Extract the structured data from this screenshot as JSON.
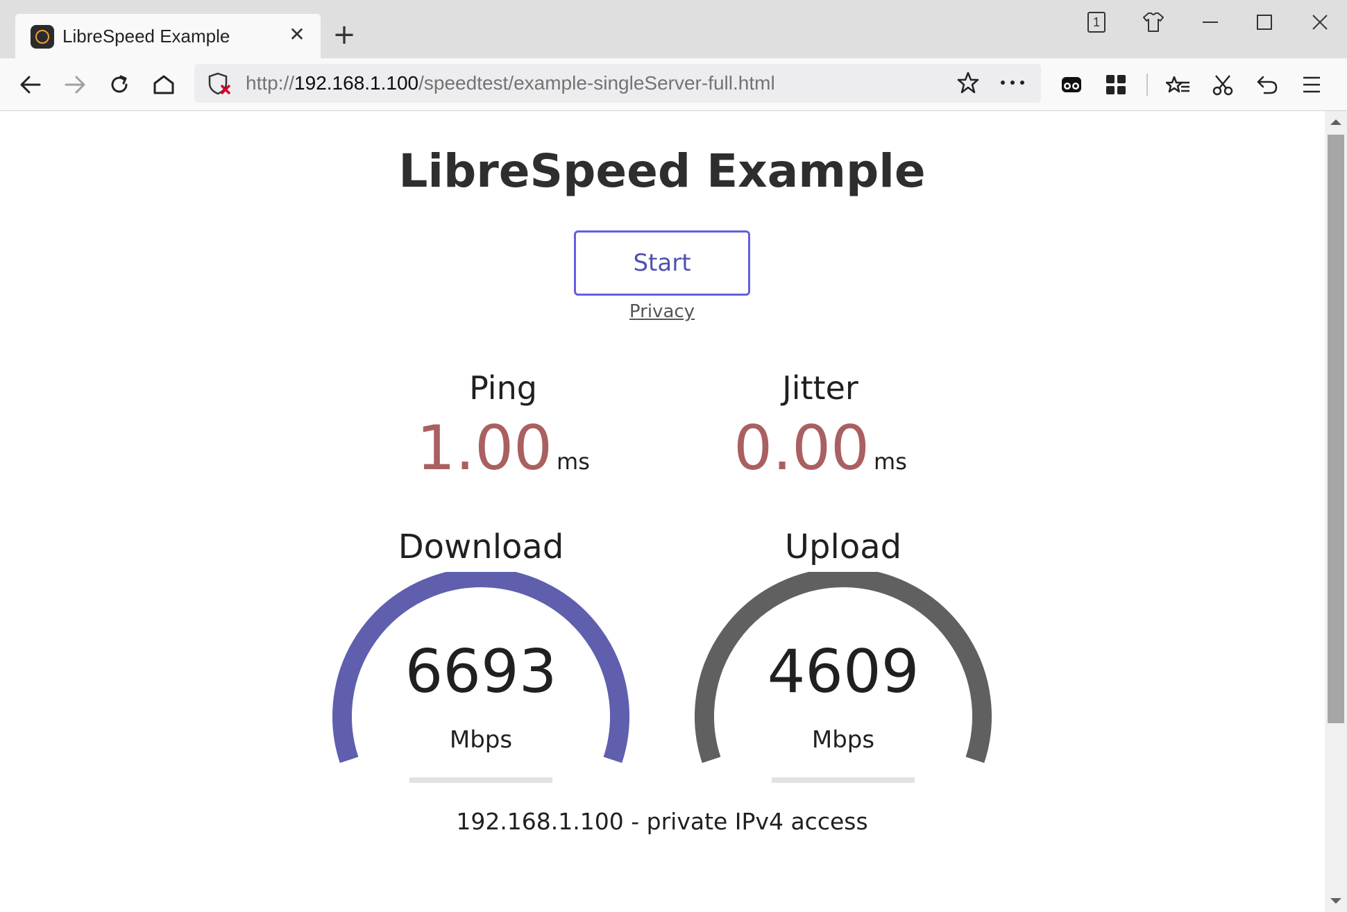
{
  "browser": {
    "tab_title": "LibreSpeed Example",
    "url_prefix": "http://",
    "url_host": "192.168.1.100",
    "url_path": "/speedtest/example-singleServer-full.html",
    "window_count_badge": "1"
  },
  "page": {
    "title": "LibreSpeed Example",
    "start_label": "Start",
    "privacy_label": "Privacy",
    "ping": {
      "label": "Ping",
      "value": "1.00",
      "unit": "ms"
    },
    "jitter": {
      "label": "Jitter",
      "value": "0.00",
      "unit": "ms"
    },
    "download": {
      "label": "Download",
      "value": "6693",
      "unit": "Mbps",
      "color": "#5f5fae"
    },
    "upload": {
      "label": "Upload",
      "value": "4609",
      "unit": "Mbps",
      "color": "#606060"
    },
    "ip_info": "192.168.1.100 - private IPv4 access"
  },
  "colors": {
    "accent": "#6060e0",
    "metric_value": "#aa6060"
  }
}
